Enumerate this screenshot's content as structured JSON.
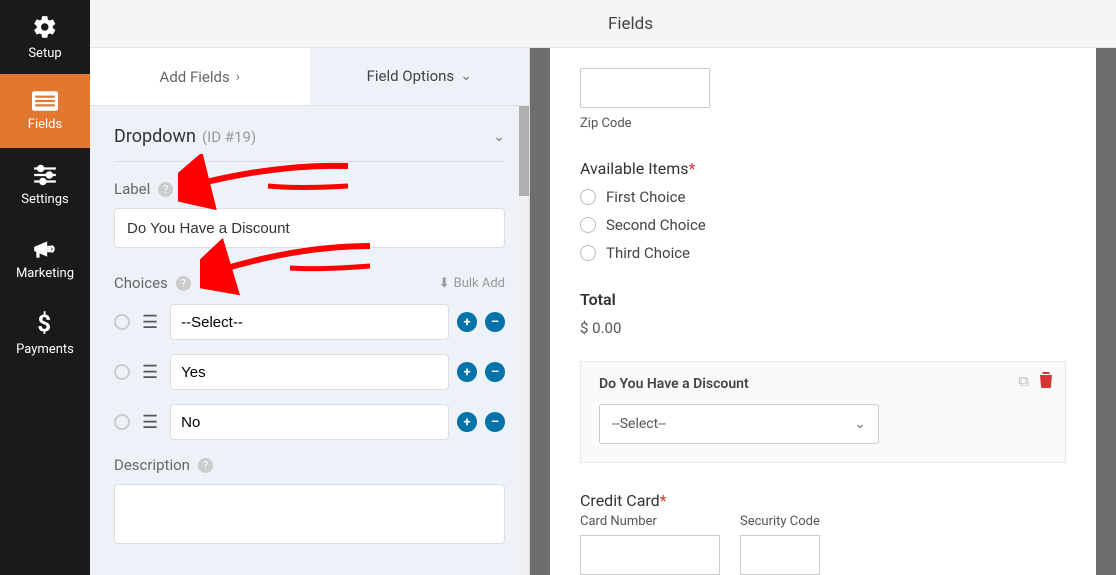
{
  "sidebar": {
    "items": [
      {
        "label": "Setup"
      },
      {
        "label": "Fields"
      },
      {
        "label": "Settings"
      },
      {
        "label": "Marketing"
      },
      {
        "label": "Payments"
      }
    ]
  },
  "topbar": {
    "title": "Fields"
  },
  "tabs": {
    "add_fields": "Add Fields",
    "field_options": "Field Options"
  },
  "field": {
    "type": "Dropdown",
    "id_label": "(ID #19)",
    "label_lbl": "Label",
    "label_value": "Do You Have a Discount",
    "choices_lbl": "Choices",
    "bulk_add": "Bulk Add",
    "choices": [
      {
        "value": "--Select--"
      },
      {
        "value": "Yes"
      },
      {
        "value": "No"
      }
    ],
    "description_lbl": "Description"
  },
  "preview": {
    "zip_label": "Zip Code",
    "available_label": "Available Items",
    "available_options": [
      "First Choice",
      "Second Choice",
      "Third Choice"
    ],
    "total_label": "Total",
    "total_value": "$ 0.00",
    "discount_label": "Do You Have a Discount",
    "discount_selected": "--Select--",
    "cc_label": "Credit Card",
    "card_number": "Card Number",
    "security_code": "Security Code"
  }
}
